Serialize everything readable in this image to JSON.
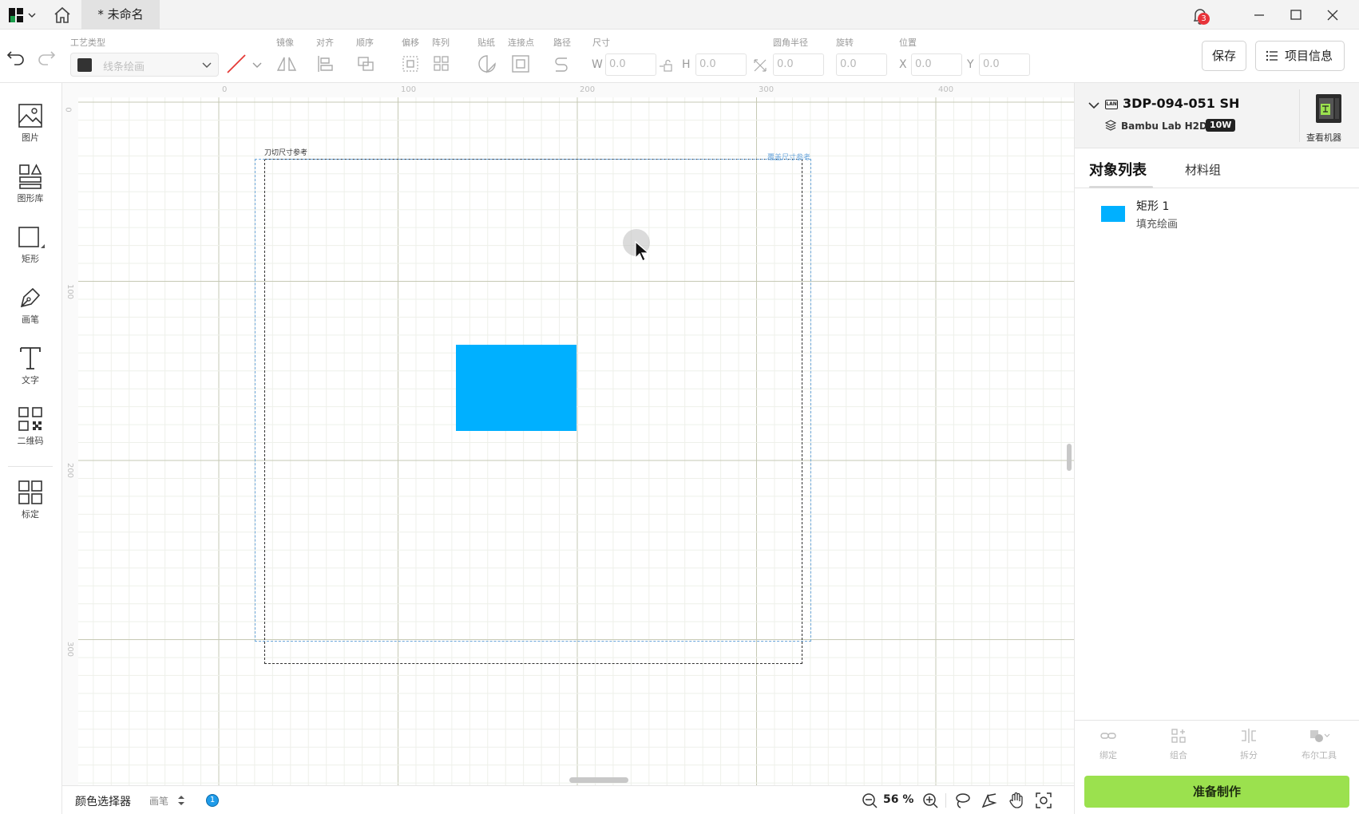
{
  "titlebar": {
    "tab_title": "* 未命名",
    "notification_count": "3"
  },
  "toolbar": {
    "craft_label": "工艺类型",
    "craft_value": "线条绘画",
    "mirror_label": "镜像",
    "align_label": "对齐",
    "order_label": "顺序",
    "offset_label": "偏移",
    "array_label": "阵列",
    "sticker_label": "贴纸",
    "connect_label": "连接点",
    "path_label": "路径",
    "size_label": "尺寸",
    "corner_label": "圆角半径",
    "rotate_label": "旋转",
    "position_label": "位置",
    "w_letter": "W",
    "h_letter": "H",
    "x_letter": "X",
    "y_letter": "Y",
    "w_value": "0.0",
    "h_value": "0.0",
    "corner_value": "0.0",
    "rotate_value": "0.0",
    "x_value": "0.0",
    "y_value": "0.0",
    "save_label": "保存",
    "info_label": "项目信息"
  },
  "sidebar": {
    "items": [
      {
        "label": "图片",
        "icon": "image-icon"
      },
      {
        "label": "图形库",
        "icon": "shapes-icon"
      },
      {
        "label": "矩形",
        "icon": "rectangle-icon"
      },
      {
        "label": "画笔",
        "icon": "pen-icon"
      },
      {
        "label": "文字",
        "icon": "text-icon"
      },
      {
        "label": "二维码",
        "icon": "qrcode-icon"
      },
      {
        "label": "标定",
        "icon": "calibrate-icon"
      }
    ]
  },
  "canvas": {
    "ruler_top": [
      "0",
      "100",
      "200",
      "300",
      "400"
    ],
    "ruler_left": [
      "0",
      "100",
      "200",
      "300"
    ],
    "cut_ref_label": "刀切尺寸参考",
    "print_ref_label": "覆盖尺寸参考",
    "colors": {
      "object_fill": "#00b0ff",
      "guide_blue": "#6fa8dc"
    }
  },
  "bottombar": {
    "color_picker": "颜色选择器",
    "pen_label": "画笔",
    "info_count": "1",
    "zoom": "56 %"
  },
  "rpanel": {
    "machine_name": "3DP-094-051 SH",
    "machine_model": "Bambu Lab H2D",
    "laser_power": "10W",
    "lan_tag": "LAN",
    "view_machine": "查看机器",
    "tab_objects": "对象列表",
    "tab_materials": "材料组",
    "objects": [
      {
        "name": "矩形 1",
        "type": "填充绘画",
        "color": "#00b0ff"
      }
    ],
    "tools": [
      "绑定",
      "组合",
      "拆分",
      "布尔工具"
    ],
    "make_label": "准备制作",
    "accent": "#9be14e"
  }
}
